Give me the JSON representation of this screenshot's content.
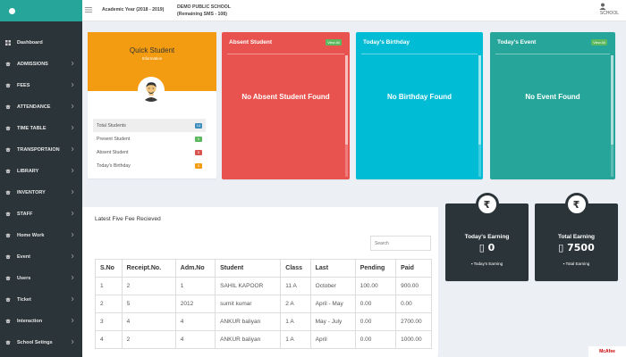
{
  "header": {
    "academic_year": "Academic Year (2018 - 2019)",
    "school_line1": "DEMO PUBLIC SCHOOL",
    "school_line2": "(Remaining SMS - 108)",
    "user_label": "SCHOOL"
  },
  "sidebar": {
    "items": [
      {
        "label": "Dashboard",
        "icon": "dashboard-icon"
      },
      {
        "label": "ADMISSIONS",
        "icon": "graduation-icon"
      },
      {
        "label": "FEES",
        "icon": "graduation-icon"
      },
      {
        "label": "ATTENDANCE",
        "icon": "graduation-icon"
      },
      {
        "label": "TIME TABLE",
        "icon": "graduation-icon"
      },
      {
        "label": "TRANSPORTAION",
        "icon": "graduation-icon"
      },
      {
        "label": "LIBRARY",
        "icon": "graduation-icon"
      },
      {
        "label": "INVENTORY",
        "icon": "graduation-icon"
      },
      {
        "label": "STAFF",
        "icon": "graduation-icon"
      },
      {
        "label": "Home Work",
        "icon": "graduation-icon"
      },
      {
        "label": "Event",
        "icon": "graduation-icon"
      },
      {
        "label": "Users",
        "icon": "graduation-icon"
      },
      {
        "label": "Ticket",
        "icon": "graduation-icon"
      },
      {
        "label": "Interaction",
        "icon": "graduation-icon"
      },
      {
        "label": "School Setings",
        "icon": "graduation-icon"
      }
    ]
  },
  "quick_student": {
    "title": "Quick Student",
    "subtitle": "Information",
    "rows": [
      {
        "label": "Total Students",
        "count": "14",
        "color": "#3c8dbc"
      },
      {
        "label": "Present Student",
        "count": "0",
        "color": "#5cb85c"
      },
      {
        "label": "Absent Student",
        "count": "0",
        "color": "#d9534f"
      },
      {
        "label": "Today's Birthday",
        "count": "0",
        "color": "#f39c12"
      }
    ]
  },
  "absent": {
    "title": "Absent Student",
    "view_all": "View All",
    "empty": "No Absent Student Found"
  },
  "birthday": {
    "title": "Today's Birthday",
    "empty": "No Birthday Found"
  },
  "event": {
    "title": "Today's Event",
    "view_all": "View All",
    "empty": "No Event Found"
  },
  "fees": {
    "title": "Latest Five Fee Recieved",
    "search_placeholder": "Search",
    "columns": [
      "S.No",
      "Receipt.No.",
      "Adm.No",
      "Student",
      "Class",
      "Last",
      "Pending",
      "Paid"
    ],
    "rows": [
      [
        "1",
        "2",
        "1",
        "SAHIL KAPOOR",
        "11 A",
        "October",
        "100.00",
        "900.00"
      ],
      [
        "2",
        "5",
        "2012",
        "sumit kumar",
        "2 A",
        "April - May",
        "0.00",
        "0.00"
      ],
      [
        "3",
        "4",
        "4",
        "ANKUR baliyan",
        "1 A",
        "May - July",
        "0.00",
        "2700.00"
      ],
      [
        "4",
        "2",
        "4",
        "ANKUR baliyan",
        "1 A",
        "April",
        "0.00",
        "1000.00"
      ]
    ]
  },
  "earnings": {
    "today": {
      "label": "Today's Earning",
      "value": "0",
      "footer": "Today's Earning"
    },
    "total": {
      "label": "Total Earning",
      "value": "7500",
      "footer": "Total Earning"
    }
  },
  "mcafee": "McAfee"
}
